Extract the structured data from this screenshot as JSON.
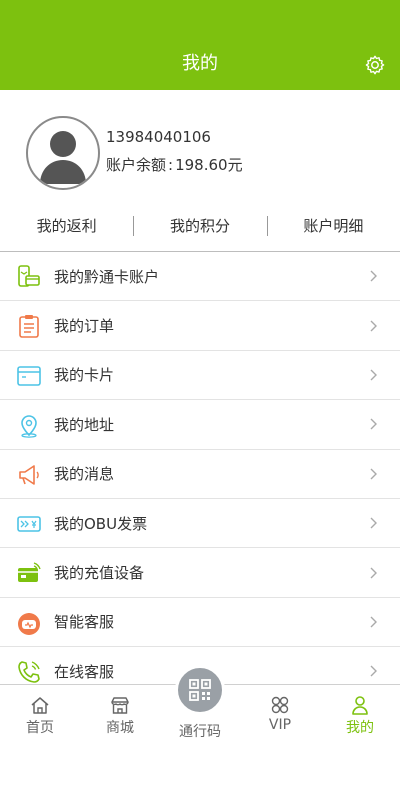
{
  "header": {
    "title": "我的",
    "settings_icon": "gear-icon"
  },
  "profile": {
    "phone": "13984040106",
    "balance_label": "账户余额",
    "balance_sep": ":",
    "balance_value": "198.60元"
  },
  "quick_links": [
    "我的返利",
    "我的积分",
    "账户明细"
  ],
  "menu": {
    "items": [
      {
        "label": "我的黔通卡账户",
        "icon": "card-account-icon"
      },
      {
        "label": "我的订单",
        "icon": "order-icon"
      },
      {
        "label": "我的卡片",
        "icon": "card-icon"
      },
      {
        "label": "我的地址",
        "icon": "location-icon"
      },
      {
        "label": "我的消息",
        "icon": "megaphone-icon"
      },
      {
        "label": "我的OBU发票",
        "icon": "invoice-icon"
      },
      {
        "label": "我的充值设备",
        "icon": "recharge-device-icon"
      },
      {
        "label": "智能客服",
        "icon": "robot-icon"
      },
      {
        "label": "在线客服",
        "icon": "phone-icon"
      }
    ]
  },
  "tabbar": {
    "items": [
      {
        "label": "首页",
        "icon": "home-icon"
      },
      {
        "label": "商城",
        "icon": "shop-icon"
      },
      {
        "label": "通行码",
        "icon": "qr-code-icon"
      },
      {
        "label": "VIP",
        "icon": "vip-icon"
      },
      {
        "label": "我的",
        "icon": "user-icon"
      }
    ],
    "active_index": 4
  },
  "colors": {
    "accent": "#7dc10f",
    "orange": "#f07a4a",
    "cyan": "#4cc3e6",
    "gray": "#9aa0a6"
  }
}
